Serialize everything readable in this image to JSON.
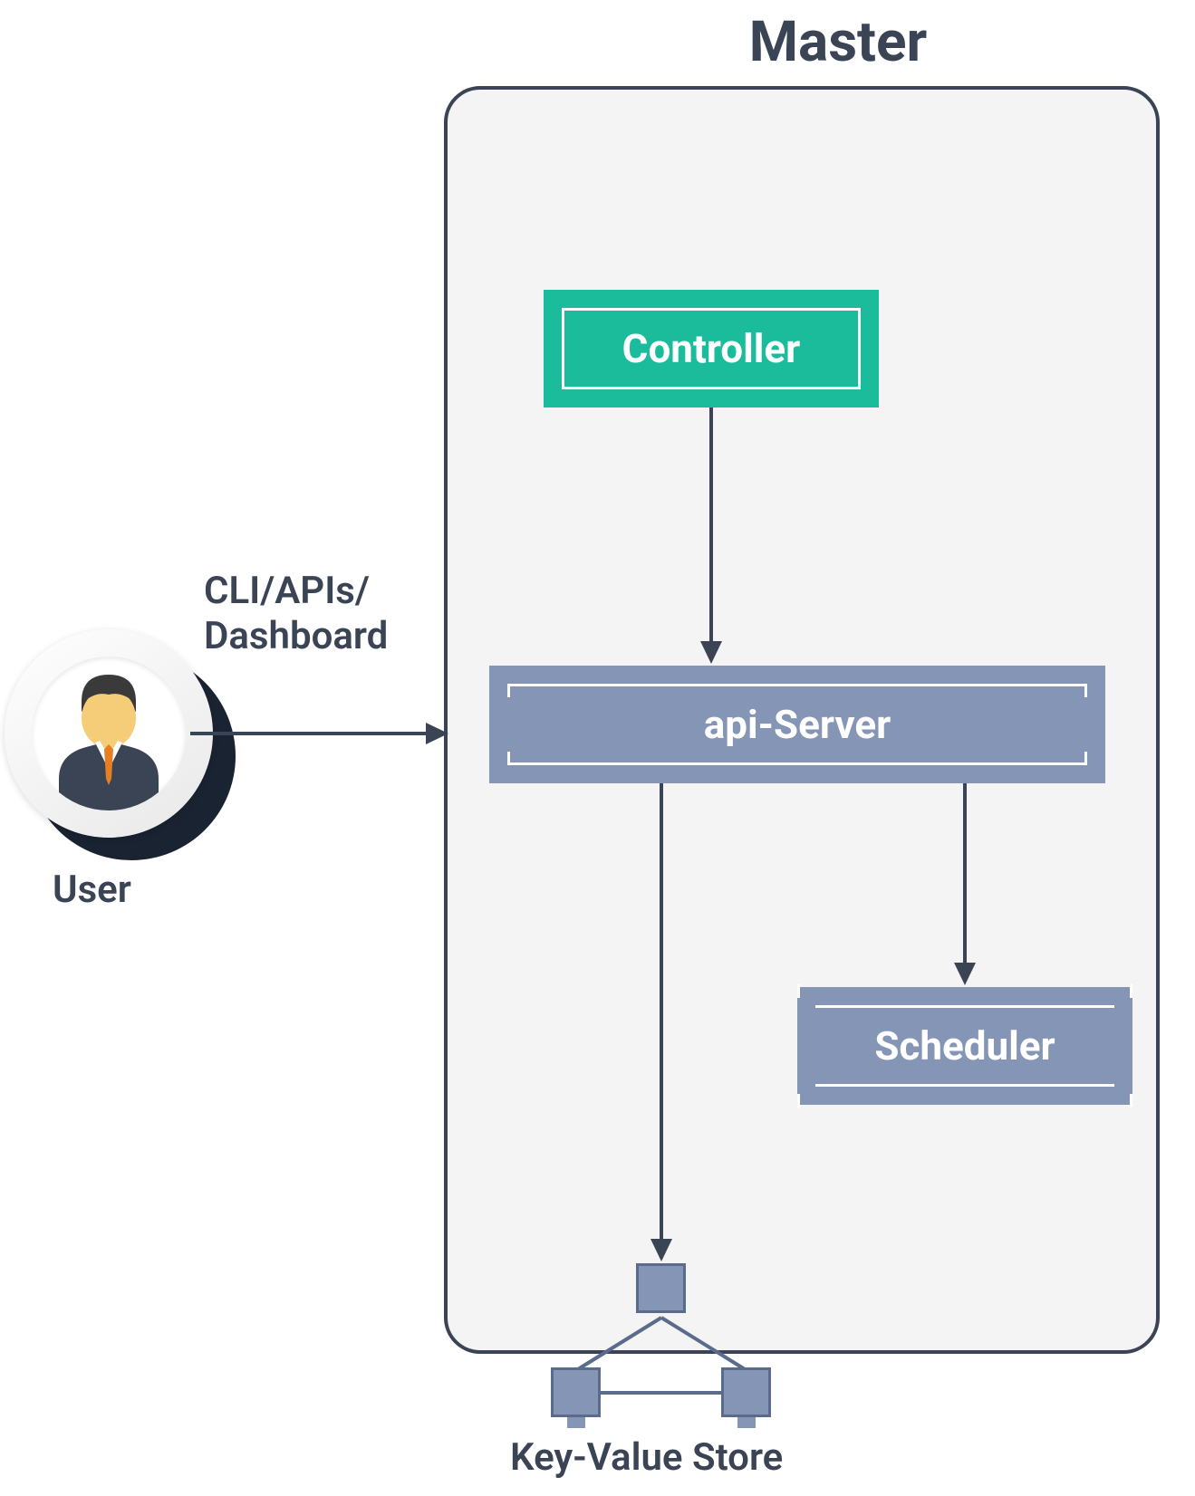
{
  "title": "Master",
  "user": {
    "label": "User"
  },
  "arrow": {
    "label_line1": "CLI/APIs/",
    "label_line2": "Dashboard"
  },
  "boxes": {
    "controller": "Controller",
    "api_server": "api-Server",
    "scheduler": "Scheduler"
  },
  "key_value_store": {
    "label": "Key-Value Store"
  },
  "colors": {
    "accent_teal": "#1abc9c",
    "box_blue": "#8495b6",
    "text_dark": "#3a4454",
    "panel_bg": "#f4f4f4"
  }
}
